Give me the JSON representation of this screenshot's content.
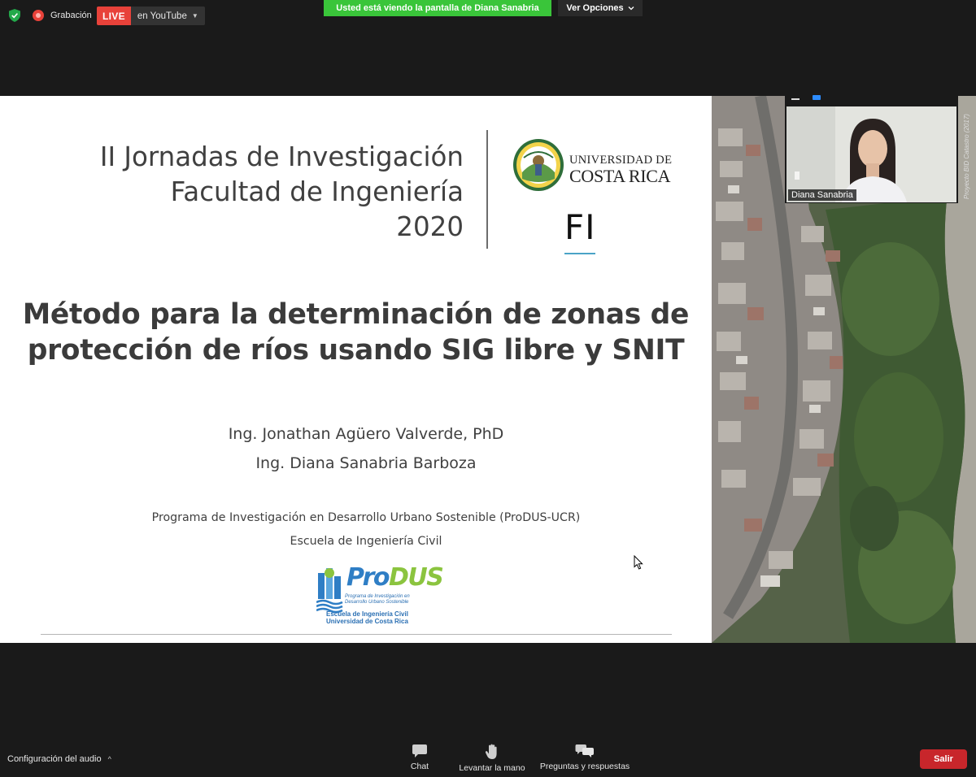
{
  "topbar": {
    "recording_label": "Grabación",
    "live_badge": "LIVE",
    "live_target": "en YouTube",
    "share_banner": "Usted está viendo la pantalla de Diana Sanabria",
    "view_options": "Ver Opciones"
  },
  "slide": {
    "conference_lines": [
      "II Jornadas de Investigación",
      "Facultad de Ingeniería",
      "2020"
    ],
    "university_line1": "UNIVERSIDAD DE",
    "university_line2": "COSTA RICA",
    "faculty_abbr": "FI",
    "title_lines": [
      "Método para la determinación de zonas de",
      "protección de ríos usando SIG libre y SNIT"
    ],
    "authors": [
      "Ing. Jonathan Agüero Valverde, PhD",
      "Ing. Diana Sanabria Barboza"
    ],
    "program_lines": [
      "Programa de Investigación en Desarrollo Urbano Sostenible (ProDUS-UCR)",
      "Escuela de Ingeniería Civil"
    ],
    "produs_logo": {
      "name_part1": "Pro",
      "name_part2": "DUS",
      "subtitle_lines": [
        "Programa de Investigación en",
        "Desarrollo Urbano Sostenible"
      ],
      "school_lines": [
        "Escuela de Ingeniería Civil",
        "Universidad de Costa Rica"
      ]
    },
    "photo_credit": "Proyecto BID Catastro (2017)"
  },
  "video_tile": {
    "participant_name": "Diana Sanabria"
  },
  "bottombar": {
    "audio_config": "Configuración del audio",
    "chat": "Chat",
    "raise_hand": "Levantar la mano",
    "qa": "Preguntas y respuestas",
    "leave": "Salir"
  },
  "colors": {
    "live_red": "#e8423a",
    "share_green": "#3ac53a",
    "leave_red": "#c8262b",
    "tile_accent": "#2d8cff"
  }
}
